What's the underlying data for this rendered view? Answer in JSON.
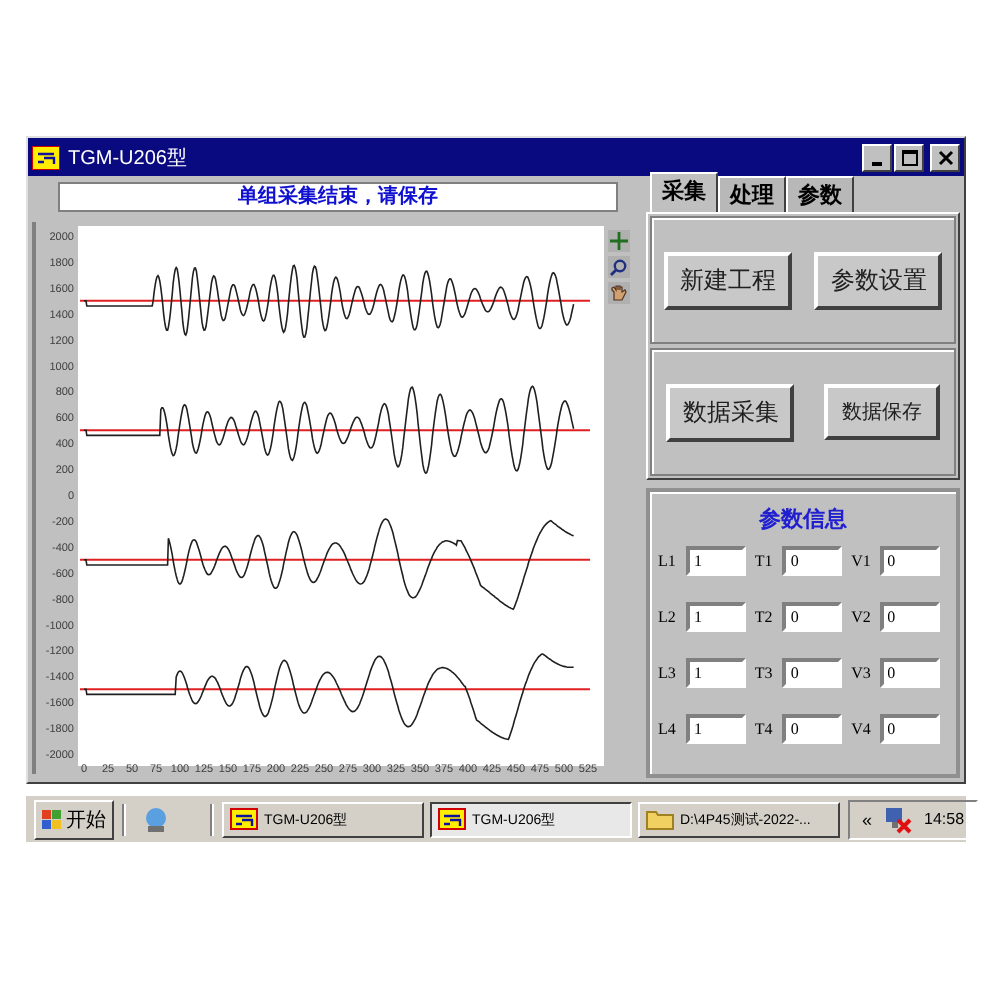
{
  "window": {
    "title": "TGM-U206型"
  },
  "status_message": "单组采集结束，请保存",
  "chart": {
    "yticks": [
      "2000",
      "1800",
      "1600",
      "1400",
      "1200",
      "1000",
      "800",
      "600",
      "400",
      "200",
      "0",
      "-200",
      "-400",
      "-600",
      "-800",
      "-1000",
      "-1200",
      "-1400",
      "-1600",
      "-1800",
      "-2000"
    ],
    "xticks": [
      "0",
      "25",
      "50",
      "75",
      "100",
      "125",
      "150",
      "175",
      "200",
      "225",
      "250",
      "275",
      "300",
      "325",
      "350",
      "375",
      "400",
      "425",
      "450",
      "475",
      "500",
      "525"
    ]
  },
  "tabs": [
    {
      "label": "采集",
      "selected": true
    },
    {
      "label": "处理",
      "selected": false
    },
    {
      "label": "参数",
      "selected": false
    }
  ],
  "button_groups": [
    [
      "新建工程",
      "参数设置"
    ],
    [
      "数据采集",
      "数据保存"
    ]
  ],
  "params": {
    "title": "参数信息",
    "fields": [
      {
        "label": "L1",
        "value": "1"
      },
      {
        "label": "T1",
        "value": "0"
      },
      {
        "label": "V1",
        "value": "0"
      },
      {
        "label": "L2",
        "value": "1"
      },
      {
        "label": "T2",
        "value": "0"
      },
      {
        "label": "V2",
        "value": "0"
      },
      {
        "label": "L3",
        "value": "1"
      },
      {
        "label": "T3",
        "value": "0"
      },
      {
        "label": "V3",
        "value": "0"
      },
      {
        "label": "L4",
        "value": "1"
      },
      {
        "label": "T4",
        "value": "0"
      },
      {
        "label": "V4",
        "value": "0"
      }
    ]
  },
  "taskbar": {
    "start": "开始",
    "tasks": [
      {
        "label": "TGM-U206型",
        "kind": "app",
        "selected": false
      },
      {
        "label": "TGM-U206型",
        "kind": "app",
        "selected": true
      },
      {
        "label": "D:\\4P45测试-2022-...",
        "kind": "folder",
        "selected": false
      }
    ],
    "tray_expand": "«",
    "time": "14:58"
  }
}
